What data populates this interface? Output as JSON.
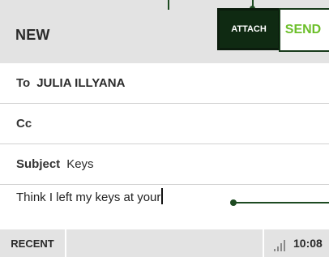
{
  "header": {
    "title": "NEW",
    "attach_label": "ATTACH",
    "send_label": "SEND"
  },
  "fields": {
    "to_label": "To",
    "to_value": "JULIA ILLYANA",
    "cc_label": "Cc",
    "cc_value": "",
    "subject_label": "Subject",
    "subject_value": "Keys"
  },
  "body": {
    "text": "Think I left my keys at your"
  },
  "bottom_bar": {
    "recent_label": "RECENT",
    "signal_icon": "signal-bars-icon",
    "time": "10:08"
  },
  "colors": {
    "accent_green": "#6cbf2a",
    "dark_green": "#0f2a12",
    "bar_gray": "#e3e3e3"
  }
}
